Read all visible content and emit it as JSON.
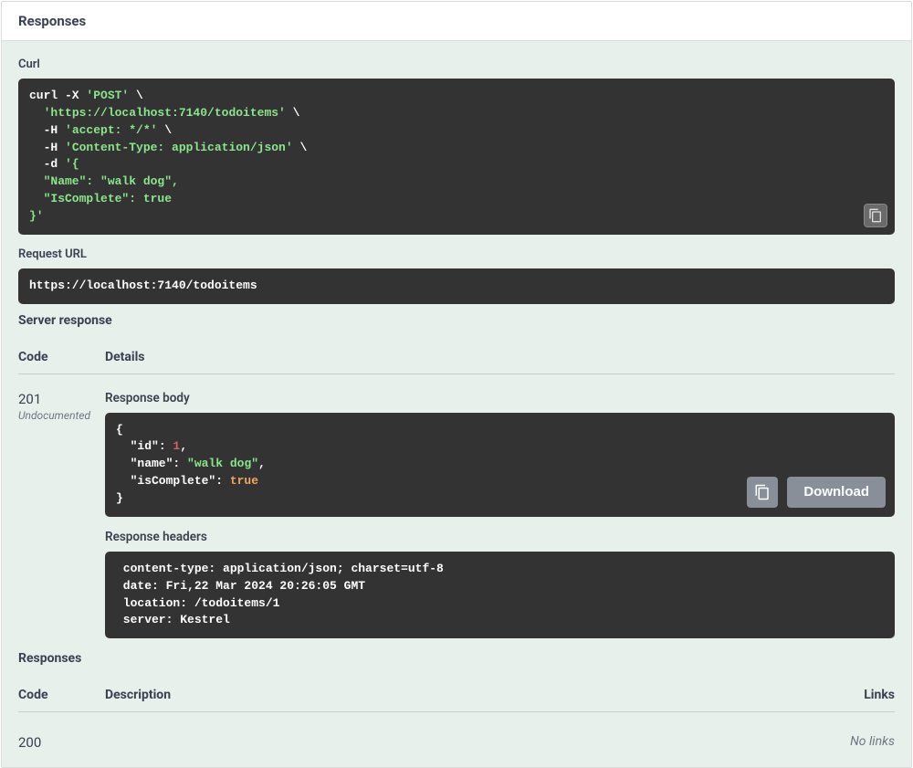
{
  "header": {
    "title": "Responses"
  },
  "curl": {
    "label": "Curl",
    "cmd": {
      "l1a": "curl -X ",
      "l1b": "'POST'",
      "l1c": " \\",
      "l2a": "  ",
      "l2b": "'https://localhost:7140/todoitems'",
      "l2c": " \\",
      "l3a": "  -H ",
      "l3b": "'accept: */*'",
      "l3c": " \\",
      "l4a": "  -H ",
      "l4b": "'Content-Type: application/json'",
      "l4c": " \\",
      "l5a": "  -d ",
      "l5b": "'{",
      "l6": "  \"Name\": \"walk dog\",",
      "l7": "  \"IsComplete\": true",
      "l8": "}'"
    }
  },
  "requestUrl": {
    "label": "Request URL",
    "value": "https://localhost:7140/todoitems"
  },
  "serverResponse": {
    "label": "Server response",
    "codeHeader": "Code",
    "detailsHeader": "Details",
    "code": "201",
    "undocumented": "Undocumented",
    "responseBodyLabel": "Response body",
    "body": {
      "open": "{",
      "l1k": "  \"id\"",
      "colon": ": ",
      "l1v": "1",
      "comma": ",",
      "l2k": "  \"name\"",
      "l2v": "\"walk dog\"",
      "l3k": "  \"isComplete\"",
      "l3v": "true",
      "close": "}"
    },
    "downloadLabel": "Download",
    "responseHeadersLabel": "Response headers",
    "headersText": " content-type: application/json; charset=utf-8 \n date: Fri,22 Mar 2024 20:26:05 GMT \n location: /todoitems/1 \n server: Kestrel "
  },
  "responses": {
    "label": "Responses",
    "codeHeader": "Code",
    "descHeader": "Description",
    "linksHeader": "Links",
    "rows": [
      {
        "code": "200",
        "desc": "",
        "links": "No links"
      }
    ]
  }
}
